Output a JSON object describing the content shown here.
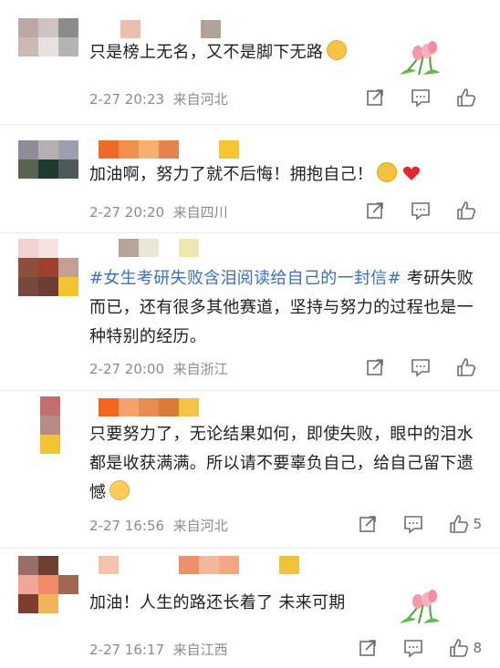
{
  "comments": [
    {
      "text": "只是榜上无名，又不是脚下无路",
      "time": "2-27 20:23",
      "location": "来自河北",
      "likes": "",
      "avatar_colors": [
        "#b9a8a5",
        "#cfc3c6",
        "#8d8a8b",
        "#cbb9b3",
        "#e9e1df",
        "#b3b3b3",
        "#ffffff",
        "#ffffff",
        "#ffffff"
      ],
      "name_colors": [
        "#e9c0ae",
        "#ffffff",
        "#ffffff",
        "#ffffff",
        "#b3a196"
      ],
      "emoji": "grinning-face-with-sweat",
      "sticker": "tulip-bouquet"
    },
    {
      "text": "加油啊，努力了就不后悔！拥抱自己！",
      "time": "2-27 20:20",
      "location": "来自四川",
      "likes": "",
      "avatar_colors": [
        "#8e8c9b",
        "#b7aeb2",
        "#9c9faf",
        "#5b6451",
        "#1f3a2e",
        "#4d5a57",
        "#ffffff",
        "#ffffff",
        "#ffffff"
      ],
      "name_colors": [
        "#f06b26",
        "#f28f4d",
        "#f6b070",
        "#e7834a",
        "#ffffff",
        "#ffffff",
        "#f4c535"
      ],
      "emoji": "hugging-face",
      "emoji2": "red-heart"
    },
    {
      "text_hashtag": "#女生考研失败含泪阅读给自己的一封信#",
      "text": " 考研失败而已，还有很多其他赛道，坚持与努力的过程也是一种特别的经历。",
      "time": "2-27 20:00",
      "location": "来自浙江",
      "likes": "",
      "avatar_colors": [
        "#f2d2d0",
        "#f6e2e0",
        "#ffffff",
        "#8e4d3d",
        "#a13e2d",
        "#c49f91",
        "#77473e",
        "#6b3d34",
        "#f2c230"
      ],
      "name_colors": [
        "#ffffff",
        "#b4a595",
        "#e9e5d7",
        "#ffffff",
        "#efe7b0"
      ]
    },
    {
      "text": "只要努力了，无论结果如何，即使失败，眼中的泪水都是收获满满。所以请不要辜负自己，给自己留下遗憾",
      "time": "2-27 16:56",
      "location": "来自河北",
      "likes": "5",
      "avatar_colors": [
        "#ffffff",
        "#c46e6d",
        "#ffffff",
        "#ffffff",
        "#b88b87",
        "#ffffff",
        "#ffffff",
        "#f3c432",
        "#ffffff"
      ],
      "name_colors": [
        "#f2651f",
        "#f4a36b",
        "#e78c53",
        "#d97a36",
        "#f4c14a"
      ],
      "emoji": "person-raising-hand"
    },
    {
      "text": "加油！人生的路还长着了 未来可期",
      "time": "2-27 16:17",
      "location": "来自江西",
      "likes": "8",
      "avatar_colors": [
        "#9a6e66",
        "#6f3f35",
        "#ffffff",
        "#f1a696",
        "#f08a6b",
        "#a4674e",
        "#7c3d2f",
        "#f3b35c",
        "#ffffff"
      ],
      "name_colors": [
        "#f4c2ad",
        "#ffffff",
        "#ffffff",
        "#ffffff",
        "#ec9069",
        "#f5b89d",
        "#f7a67f",
        "#ffffff",
        "#ffffff",
        "#f0c33a"
      ],
      "sticker": "tulip-bouquet"
    }
  ],
  "icons": {
    "share": "share-icon",
    "comment": "comment-icon",
    "like": "thumbs-up-icon"
  }
}
